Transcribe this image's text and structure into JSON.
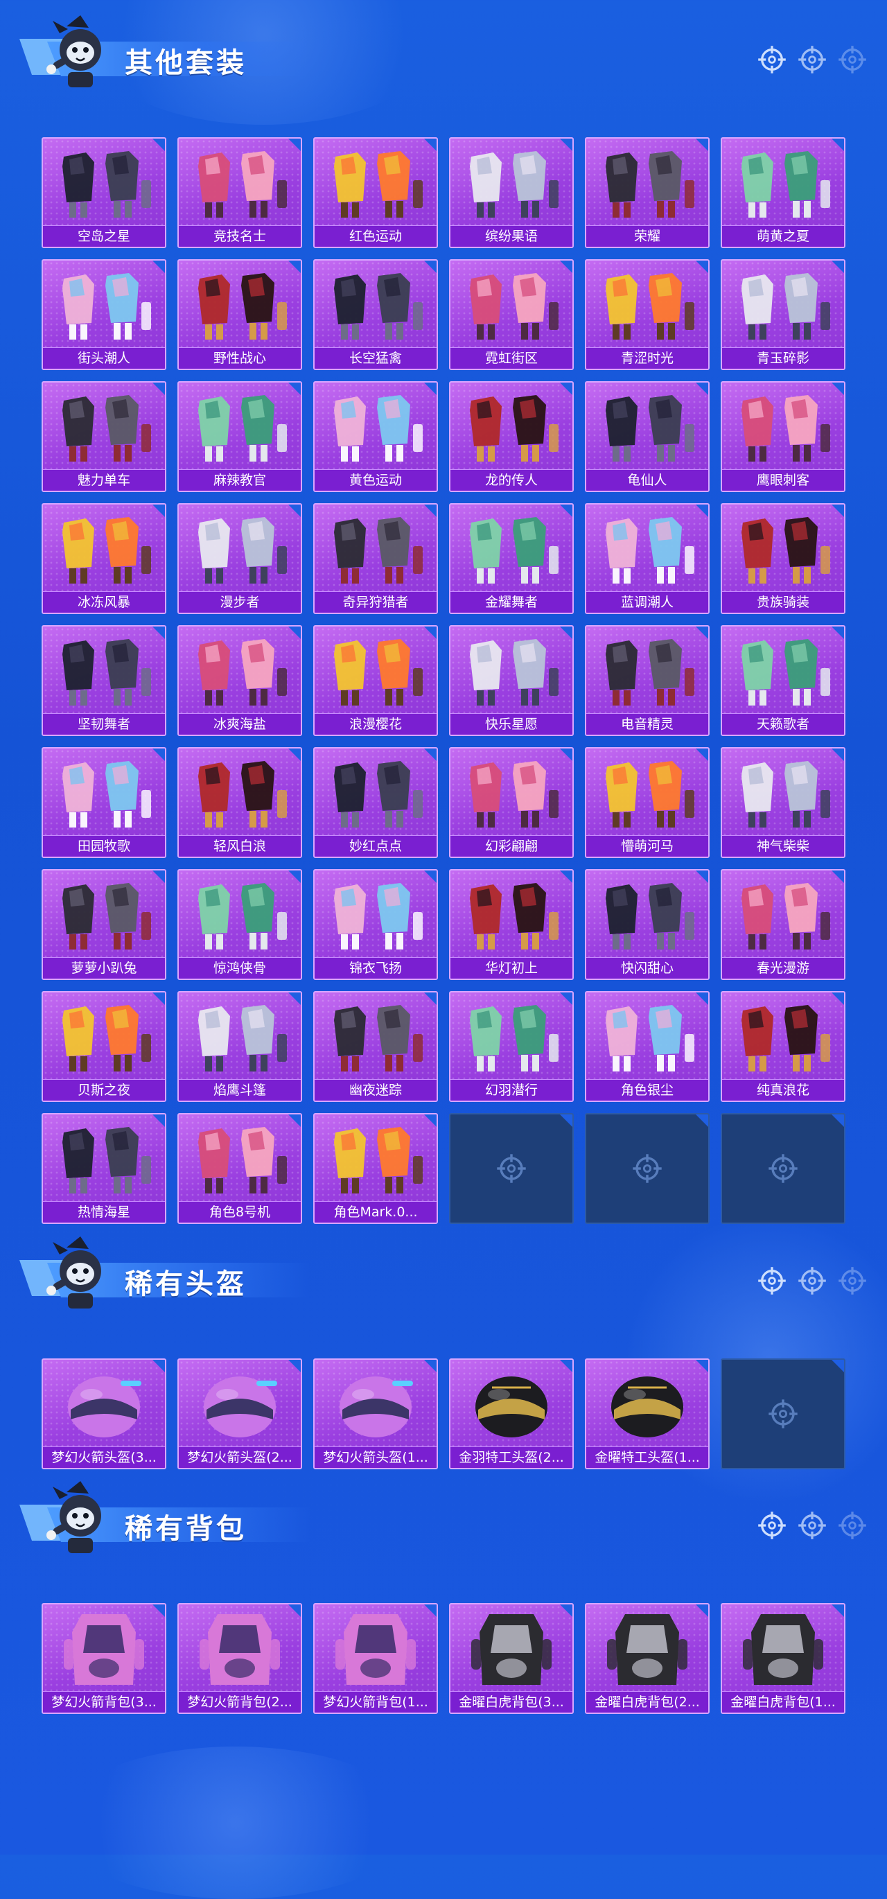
{
  "sections": [
    {
      "title": "其他套装",
      "items": [
        "空岛之星",
        "竞技名士",
        "红色运动",
        "缤纷果语",
        "荣耀",
        "萌黄之夏",
        "街头潮人",
        "野性战心",
        "长空猛禽",
        "霓虹街区",
        "青涩时光",
        "青玉碎影",
        "魅力单车",
        "麻辣教官",
        "黄色运动",
        "龙的传人",
        "龟仙人",
        "鹰眼刺客",
        "冰冻风暴",
        "漫步者",
        "奇异狩猎者",
        "金耀舞者",
        "蓝调潮人",
        "贵族骑装",
        "坚韧舞者",
        "冰爽海盐",
        "浪漫樱花",
        "快乐星愿",
        "电音精灵",
        "天籁歌者",
        "田园牧歌",
        "轻风白浪",
        "妙红点点",
        "幻彩翩翩",
        "懵萌河马",
        "神气柴柴",
        "萝萝小趴兔",
        "惊鸿侠骨",
        "锦衣飞扬",
        "华灯初上",
        "快闪甜心",
        "春光漫游",
        "贝斯之夜",
        "焰鹰斗篷",
        "幽夜迷踪",
        "幻羽潜行",
        "角色银尘",
        "纯真浪花",
        "热情海星",
        "角色8号机",
        "角色Mark.0..."
      ],
      "empty_slots": 3
    },
    {
      "title": "稀有头盔",
      "items": [
        "梦幻火箭头盔(3...",
        "梦幻火箭头盔(2...",
        "梦幻火箭头盔(1...",
        "金羽特工头盔(2...",
        "金曜特工头盔(1..."
      ],
      "empty_slots": 1
    },
    {
      "title": "稀有背包",
      "items": [
        "梦幻火箭背包(3...",
        "梦幻火箭背包(2...",
        "梦幻火箭背包(1...",
        "金曜白虎背包(3...",
        "金曜白虎背包(2...",
        "金曜白虎背包(1..."
      ],
      "empty_slots": 0
    }
  ],
  "colors": {
    "background": "#1553d6",
    "card_purple": "#9a3fe0",
    "label_purple": "#7a1fd1",
    "empty_slot": "#1e3f78"
  },
  "icons": {
    "header": "mascot-icon",
    "section_corner": "crosshair-icon",
    "empty_slot": "crosshair-icon"
  }
}
